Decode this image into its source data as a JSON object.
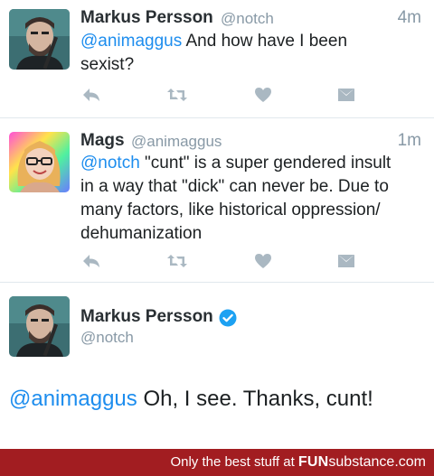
{
  "tweets": [
    {
      "name": "Markus Persson",
      "handle": "@notch",
      "time": "4m",
      "mention": "@animaggus",
      "text_rest": " And how have I been",
      "text_line2": "sexist?"
    },
    {
      "name": "Mags",
      "handle": "@animaggus",
      "time": "1m",
      "mention": "@notch",
      "line1_rest": " \"cunt\" is a super gendered insult",
      "line2": "in a way that \"dick\" can never be. Due to",
      "line3": "many factors, like historical oppression/",
      "line4": "dehumanization"
    }
  ],
  "detail": {
    "name": "Markus Persson",
    "handle": "@notch",
    "mention": "@animaggus",
    "text_rest": " Oh, I see. Thanks, cunt!"
  },
  "footer": {
    "prefix": "Only the best stuff at ",
    "brand_bold": "FUN",
    "brand_rest": "substance.com"
  },
  "colors": {
    "mention": "#1d8dee",
    "icon": "#aab8c2",
    "verified": "#1da1f2",
    "footer_bg": "#a21d21"
  },
  "icons": [
    "reply-icon",
    "retweet-icon",
    "heart-icon",
    "direct-message-icon",
    "verified-icon"
  ]
}
